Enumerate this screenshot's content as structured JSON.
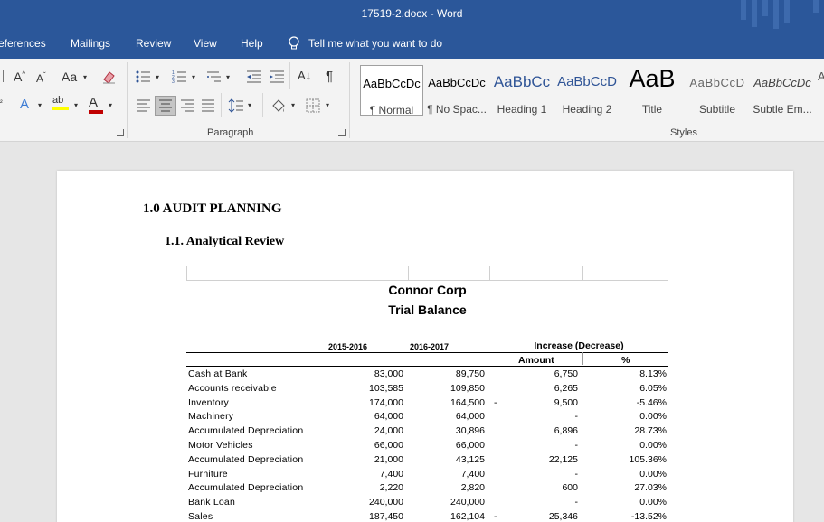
{
  "window": {
    "title": "17519-2.docx  -  Word"
  },
  "tabs": [
    "eferences",
    "Mailings",
    "Review",
    "View",
    "Help"
  ],
  "tell_me": "Tell me what you want to do",
  "groups": {
    "paragraph": "Paragraph",
    "styles": "Styles"
  },
  "styles": [
    {
      "sample": "AaBbCcDc",
      "name": "¶ Normal"
    },
    {
      "sample": "AaBbCcDc",
      "name": "¶ No Spac..."
    },
    {
      "sample": "AaBbCc",
      "name": "Heading 1"
    },
    {
      "sample": "AaBbCcD",
      "name": "Heading 2"
    },
    {
      "sample": "AaB",
      "name": "Title"
    },
    {
      "sample": "AaBbCcD",
      "name": "Subtitle"
    },
    {
      "sample": "AaBbCcDc",
      "name": "Subtle Em..."
    }
  ],
  "ribbon_glyphs": {
    "grow": "A",
    "shrink": "A",
    "case": "Aa",
    "pilcrow": "¶",
    "sort": "A↓"
  },
  "document": {
    "heading1": "1.0 AUDIT PLANNING",
    "heading2": "1.1. Analytical Review",
    "company": "Connor Corp",
    "report": "Trial Balance",
    "col_year1": "2015-2016",
    "col_year2": "2016-2017",
    "col_increase": "Increase (Decrease)",
    "col_amount": "Amount",
    "col_pct": "%",
    "rows": [
      {
        "label": "Cash at Bank",
        "y1": "83,000",
        "y2": "89,750",
        "neg": "",
        "amt": "6,750",
        "pct": "8.13%"
      },
      {
        "label": "Accounts receivable",
        "y1": "103,585",
        "y2": "109,850",
        "neg": "",
        "amt": "6,265",
        "pct": "6.05%"
      },
      {
        "label": "Inventory",
        "y1": "174,000",
        "y2": "164,500",
        "neg": "-",
        "amt": "9,500",
        "pct": "-5.46%"
      },
      {
        "label": "Machinery",
        "y1": "64,000",
        "y2": "64,000",
        "neg": "",
        "amt": "-",
        "pct": "0.00%"
      },
      {
        "label": "Accumulated Depreciation",
        "y1": "24,000",
        "y2": "30,896",
        "neg": "",
        "amt": "6,896",
        "pct": "28.73%"
      },
      {
        "label": "Motor Vehicles",
        "y1": "66,000",
        "y2": "66,000",
        "neg": "",
        "amt": "-",
        "pct": "0.00%"
      },
      {
        "label": "Accumulated Depreciation",
        "y1": "21,000",
        "y2": "43,125",
        "neg": "",
        "amt": "22,125",
        "pct": "105.36%"
      },
      {
        "label": "Furniture",
        "y1": "7,400",
        "y2": "7,400",
        "neg": "",
        "amt": "-",
        "pct": "0.00%"
      },
      {
        "label": "Accumulated Depreciation",
        "y1": "2,220",
        "y2": "2,820",
        "neg": "",
        "amt": "600",
        "pct": "27.03%"
      },
      {
        "label": "Bank Loan",
        "y1": "240,000",
        "y2": "240,000",
        "neg": "",
        "amt": "-",
        "pct": "0.00%"
      },
      {
        "label": "Sales",
        "y1": "187,450",
        "y2": "162,104",
        "neg": "-",
        "amt": "25,346",
        "pct": "-13.52%"
      }
    ]
  },
  "colors": {
    "titlebar": "#2b579a",
    "ribbon": "#f3f3f3",
    "highlight": "#ffff00",
    "font_color": "#c00000",
    "heading_blue": "#2f5496"
  }
}
